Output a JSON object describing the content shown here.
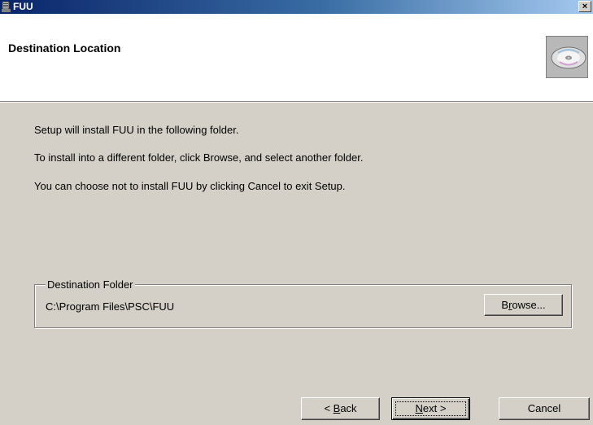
{
  "window": {
    "title": "FUU",
    "close_glyph": "×"
  },
  "header": {
    "title": "Destination Location",
    "icon": "cd-disc-icon"
  },
  "messages": [
    "Setup will install FUU in the following folder.",
    "To install into a different folder, click Browse, and select another folder.",
    "You can choose not to install FUU by clicking Cancel to exit Setup."
  ],
  "destination": {
    "group_label": "Destination Folder",
    "path": "C:\\Program Files\\PSC\\FUU",
    "browse_label_pre": "B",
    "browse_label_mnemonic": "r",
    "browse_label_post": "owse..."
  },
  "buttons": {
    "back_pre": "< ",
    "back_mnemonic": "B",
    "back_post": "ack",
    "next_mnemonic": "N",
    "next_post": "ext >",
    "cancel": "Cancel"
  }
}
